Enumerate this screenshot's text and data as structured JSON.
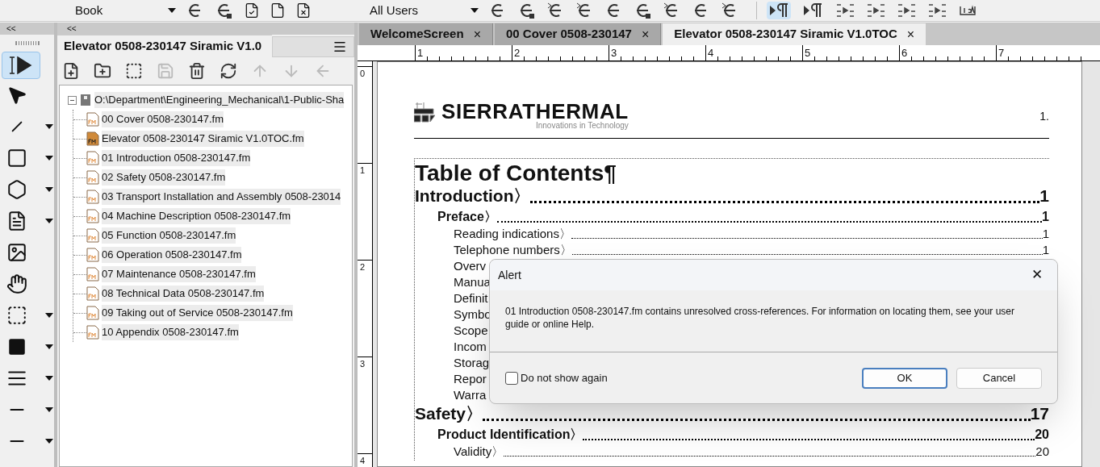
{
  "toolbar": {
    "book_dropdown": "Book",
    "users_dropdown": "All Users"
  },
  "panel": {
    "title": "Elevator 0508-230147 Siramic V1.0",
    "collapse": "<<",
    "palette_collapse": "<<",
    "tree": {
      "label": "O:\\Department\\Engineering_Mechanical\\1-Public-Sha",
      "expanded": true,
      "children": [
        {
          "label": "00 Cover 0508-230147.fm",
          "active": false
        },
        {
          "label": "Elevator 0508-230147 Siramic V1.0TOC.fm",
          "active": true
        },
        {
          "label": "01 Introduction 0508-230147.fm",
          "active": false
        },
        {
          "label": "02 Safety 0508-230147.fm",
          "active": false
        },
        {
          "label": "03 Transport Installation and Assembly 0508-23014",
          "active": false
        },
        {
          "label": "04 Machine Description 0508-230147.fm",
          "active": false
        },
        {
          "label": "05 Function 0508-230147.fm",
          "active": false
        },
        {
          "label": "06 Operation 0508-230147.fm",
          "active": false
        },
        {
          "label": "07 Maintenance 0508-230147.fm",
          "active": false
        },
        {
          "label": "08 Technical Data 0508-230147.fm",
          "active": false
        },
        {
          "label": "09 Taking out of Service 0508-230147.fm",
          "active": false
        },
        {
          "label": "10 Appendix 0508-230147.fm",
          "active": false
        }
      ]
    }
  },
  "tabs": [
    {
      "label": "WelcomeScreen",
      "close": "×",
      "selected": false
    },
    {
      "label": "00 Cover 0508-230147",
      "close": "×",
      "selected": false
    },
    {
      "label": "Elevator 0508-230147 Siramic V1.0TOC",
      "close": "×",
      "selected": true
    }
  ],
  "ruler": {
    "marks": [
      "1",
      "2",
      "3",
      "4",
      "5",
      "6",
      "7"
    ],
    "vertical_marks": [
      "0",
      "1",
      "2",
      "3",
      "4"
    ]
  },
  "document": {
    "logo": {
      "name": "SIERRATHERMAL",
      "tagline": "Innovations in Technology"
    },
    "page_number": "1.",
    "heading": "Table of Contents¶",
    "entries": [
      {
        "kind": "chapter",
        "text": "Introduction〉",
        "page": "1"
      },
      {
        "kind": "section",
        "text": "Preface〉",
        "page": "1"
      },
      {
        "kind": "topic",
        "text": "Reading indications〉",
        "page": "1"
      },
      {
        "kind": "topic",
        "text": "Telephone numbers〉",
        "page": "1"
      },
      {
        "kind": "topic",
        "text": "Overv"
      },
      {
        "kind": "topic",
        "text": "Manua"
      },
      {
        "kind": "topic",
        "text": "Definit"
      },
      {
        "kind": "topic",
        "text": "Symbo"
      },
      {
        "kind": "topic",
        "text": "Scope"
      },
      {
        "kind": "topic",
        "text": "Incom"
      },
      {
        "kind": "topic",
        "text": "Storag"
      },
      {
        "kind": "topic",
        "text": "Repor"
      },
      {
        "kind": "topic",
        "text": "Warra"
      },
      {
        "kind": "chapter",
        "text": "Safety〉",
        "page": "17"
      },
      {
        "kind": "section",
        "text": "Product Identification〉",
        "page": "20"
      },
      {
        "kind": "topic",
        "text": "Validity〉",
        "page": "20"
      }
    ]
  },
  "dialog": {
    "title": "Alert",
    "close": "✕",
    "message": "01 Introduction 0508-230147.fm contains unresolved cross-references. For information on locating them, see your user guide or online Help.",
    "checkbox": {
      "label": "Do not show again",
      "checked": false
    },
    "buttons": [
      "OK",
      "Cancel"
    ]
  }
}
